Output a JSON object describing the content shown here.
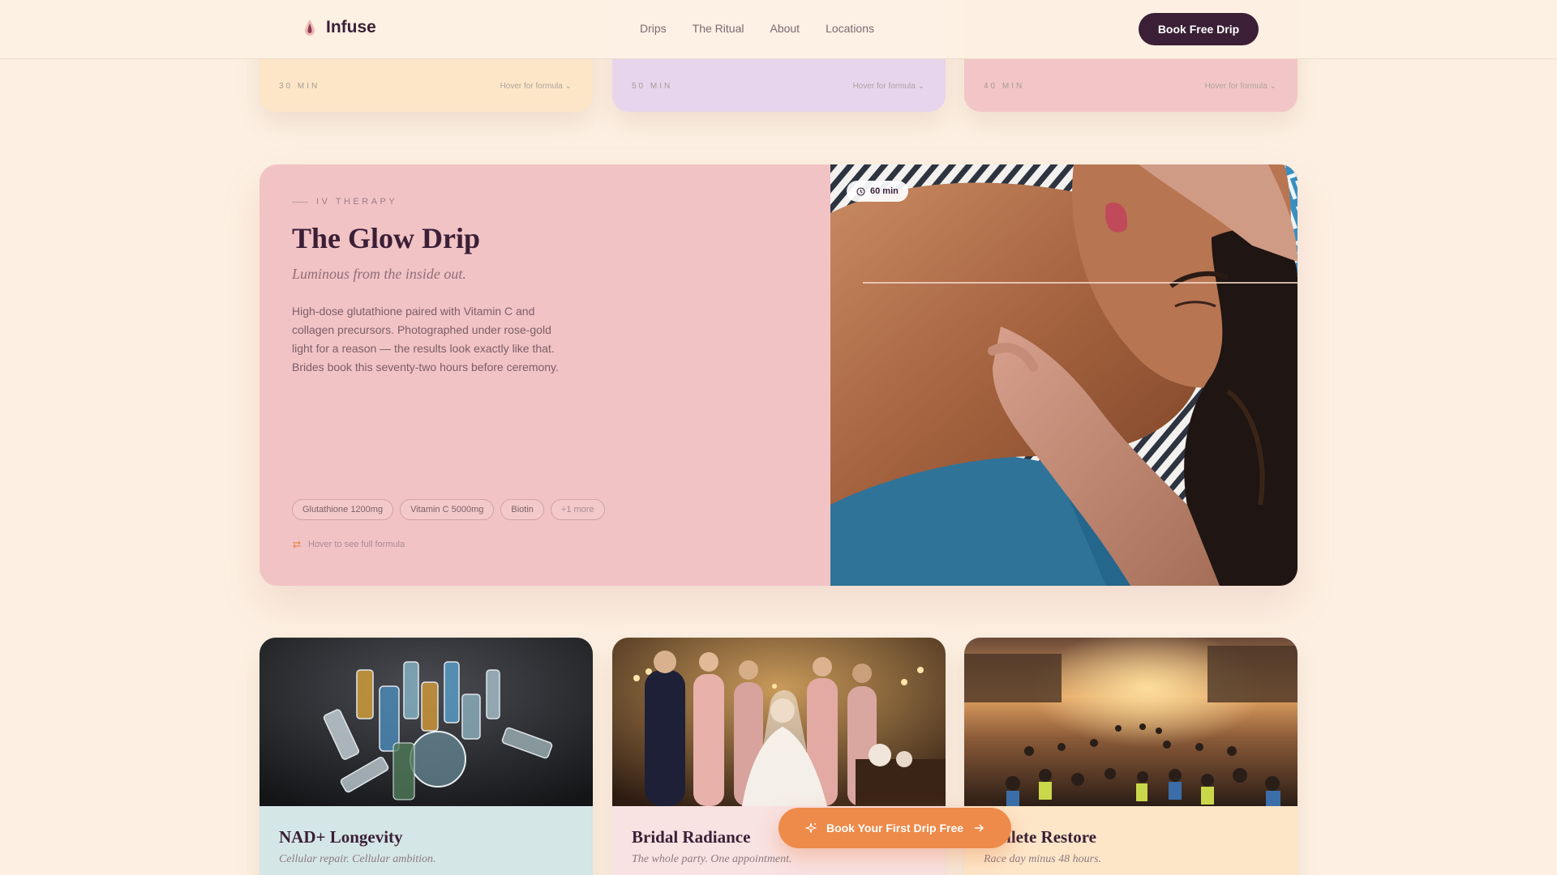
{
  "header": {
    "brand": "Infuse",
    "nav": [
      "Drips",
      "The Ritual",
      "About",
      "Locations"
    ],
    "cta_label": "Book Free Drip"
  },
  "top_cards": [
    {
      "duration": "30 MIN",
      "hint": "Hover for formula",
      "color": "#fde6c8"
    },
    {
      "duration": "50 MIN",
      "hint": "Hover for formula",
      "color": "#e6d5ec"
    },
    {
      "duration": "40 MIN",
      "hint": "Hover for formula",
      "color": "#f2c6c6"
    }
  ],
  "feature": {
    "kicker": "IV THERAPY",
    "title": "The Glow Drip",
    "subtitle": "Luminous from the inside out.",
    "description": "High-dose glutathione paired with Vitamin C and collagen precursors. Photographed under rose-gold light for a reason — the results look exactly like that. Brides book this seventy-two hours before ceremony.",
    "ingredients": [
      "Glutathione 1200mg",
      "Vitamin C 5000mg",
      "Biotin"
    ],
    "more_label": "+1 more",
    "hint": "Hover to see full formula",
    "duration_badge": "60 min",
    "background": "#f2c3c5"
  },
  "cards": [
    {
      "title": "NAD+ Longevity",
      "subtitle": "Cellular repair. Cellular ambition.",
      "color": "#d4e6e5"
    },
    {
      "title": "Bridal Radiance",
      "subtitle": "The whole party. One appointment.",
      "color": "#f9e2e2"
    },
    {
      "title": "Athlete Restore",
      "subtitle": "Race day minus 48 hours.",
      "color": "#fde6c8"
    }
  ],
  "floating_cta": {
    "label": "Book Your First Drip Free",
    "color": "#ee8a4a"
  },
  "icons": [
    "drop-logo-icon",
    "swap-arrows-icon",
    "clock-icon",
    "sparkle-icon",
    "arrow-right-icon"
  ]
}
